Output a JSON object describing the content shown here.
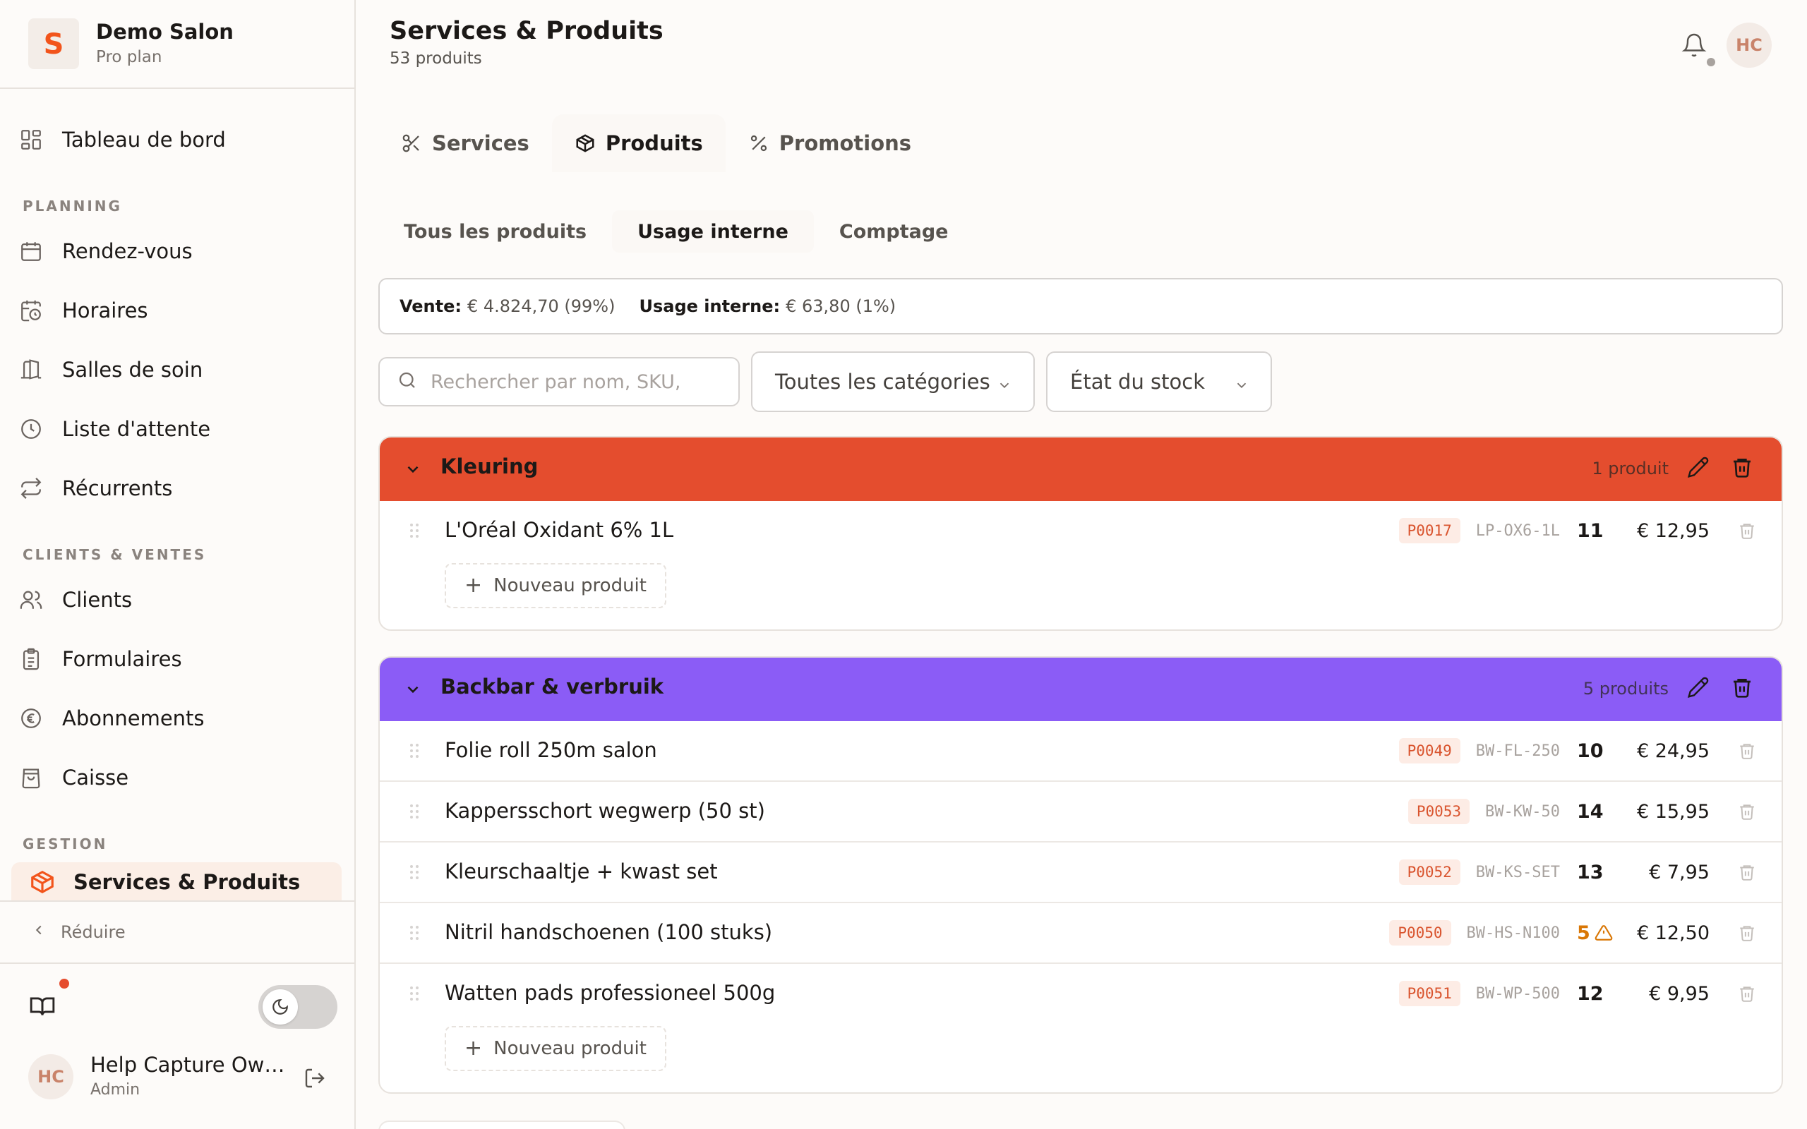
{
  "brand": {
    "name": "Demo Salon",
    "plan": "Pro plan",
    "logo_letter": "S",
    "accent": "#f2541b"
  },
  "nav": {
    "dashboard": "Tableau de bord",
    "sections": {
      "planning": "PLANNING",
      "clients_sales": "CLIENTS & VENTES",
      "management": "GESTION"
    },
    "planning_items": [
      {
        "label": "Rendez-vous",
        "icon": "calendar-icon"
      },
      {
        "label": "Horaires",
        "icon": "calendar-clock-icon"
      },
      {
        "label": "Salles de soin",
        "icon": "door-icon"
      },
      {
        "label": "Liste d'attente",
        "icon": "clock-icon"
      },
      {
        "label": "Récurrents",
        "icon": "repeat-icon"
      }
    ],
    "clients_items": [
      {
        "label": "Clients",
        "icon": "users-icon"
      },
      {
        "label": "Formulaires",
        "icon": "clipboard-icon"
      },
      {
        "label": "Abonnements",
        "icon": "euro-coin-icon"
      },
      {
        "label": "Caisse",
        "icon": "shopping-bag-icon"
      }
    ],
    "active_item": "Services & Produits",
    "collapse": "Réduire"
  },
  "user": {
    "initials": "HC",
    "name": "Help Capture Owner",
    "role": "Admin"
  },
  "header": {
    "title": "Services & Produits",
    "subtitle": "53 produits",
    "avatar_initials": "HC"
  },
  "tabs": [
    {
      "label": "Services",
      "icon": "scissors-icon",
      "active": false
    },
    {
      "label": "Produits",
      "icon": "package-icon",
      "active": true
    },
    {
      "label": "Promotions",
      "icon": "percent-icon",
      "active": false
    }
  ],
  "subtabs": [
    {
      "label": "Tous les produits",
      "active": false
    },
    {
      "label": "Usage interne",
      "active": true
    },
    {
      "label": "Comptage",
      "active": false
    }
  ],
  "summary": {
    "sale_label": "Vente:",
    "sale_value": "€ 4.824,70 (99%)",
    "internal_label": "Usage interne:",
    "internal_value": "€ 63,80 (1%)"
  },
  "filters": {
    "search_placeholder": "Rechercher par nom, SKU,",
    "category": "Toutes les catégories",
    "stock": "État du stock"
  },
  "categories": [
    {
      "name": "Kleuring",
      "count": "1 produit",
      "color": "#e44d2e",
      "add_label": "Nouveau produit",
      "products": [
        {
          "name": "L'Oréal Oxidant 6% 1L",
          "code": "P0017",
          "sku": "LP-OX6-1L",
          "stock": "11",
          "price": "€ 12,95"
        }
      ]
    },
    {
      "name": "Backbar & verbruik",
      "count": "5 produits",
      "color": "#8b5cf6",
      "add_label": "Nouveau produit",
      "products": [
        {
          "name": "Folie roll 250m salon",
          "code": "P0049",
          "sku": "BW-FL-250",
          "stock": "10",
          "price": "€ 24,95"
        },
        {
          "name": "Kappersschort wegwerp (50 st)",
          "code": "P0053",
          "sku": "BW-KW-50",
          "stock": "14",
          "price": "€ 15,95"
        },
        {
          "name": "Kleurschaaltje + kwast set",
          "code": "P0052",
          "sku": "BW-KS-SET",
          "stock": "13",
          "price": "€ 7,95"
        },
        {
          "name": "Nitril handschoenen (100 stuks)",
          "code": "P0050",
          "sku": "BW-HS-N100",
          "stock": "5",
          "price": "€ 12,50",
          "low_stock": true
        },
        {
          "name": "Watten pads professioneel 500g",
          "code": "P0051",
          "sku": "BW-WP-500",
          "stock": "12",
          "price": "€ 9,95"
        }
      ]
    }
  ]
}
